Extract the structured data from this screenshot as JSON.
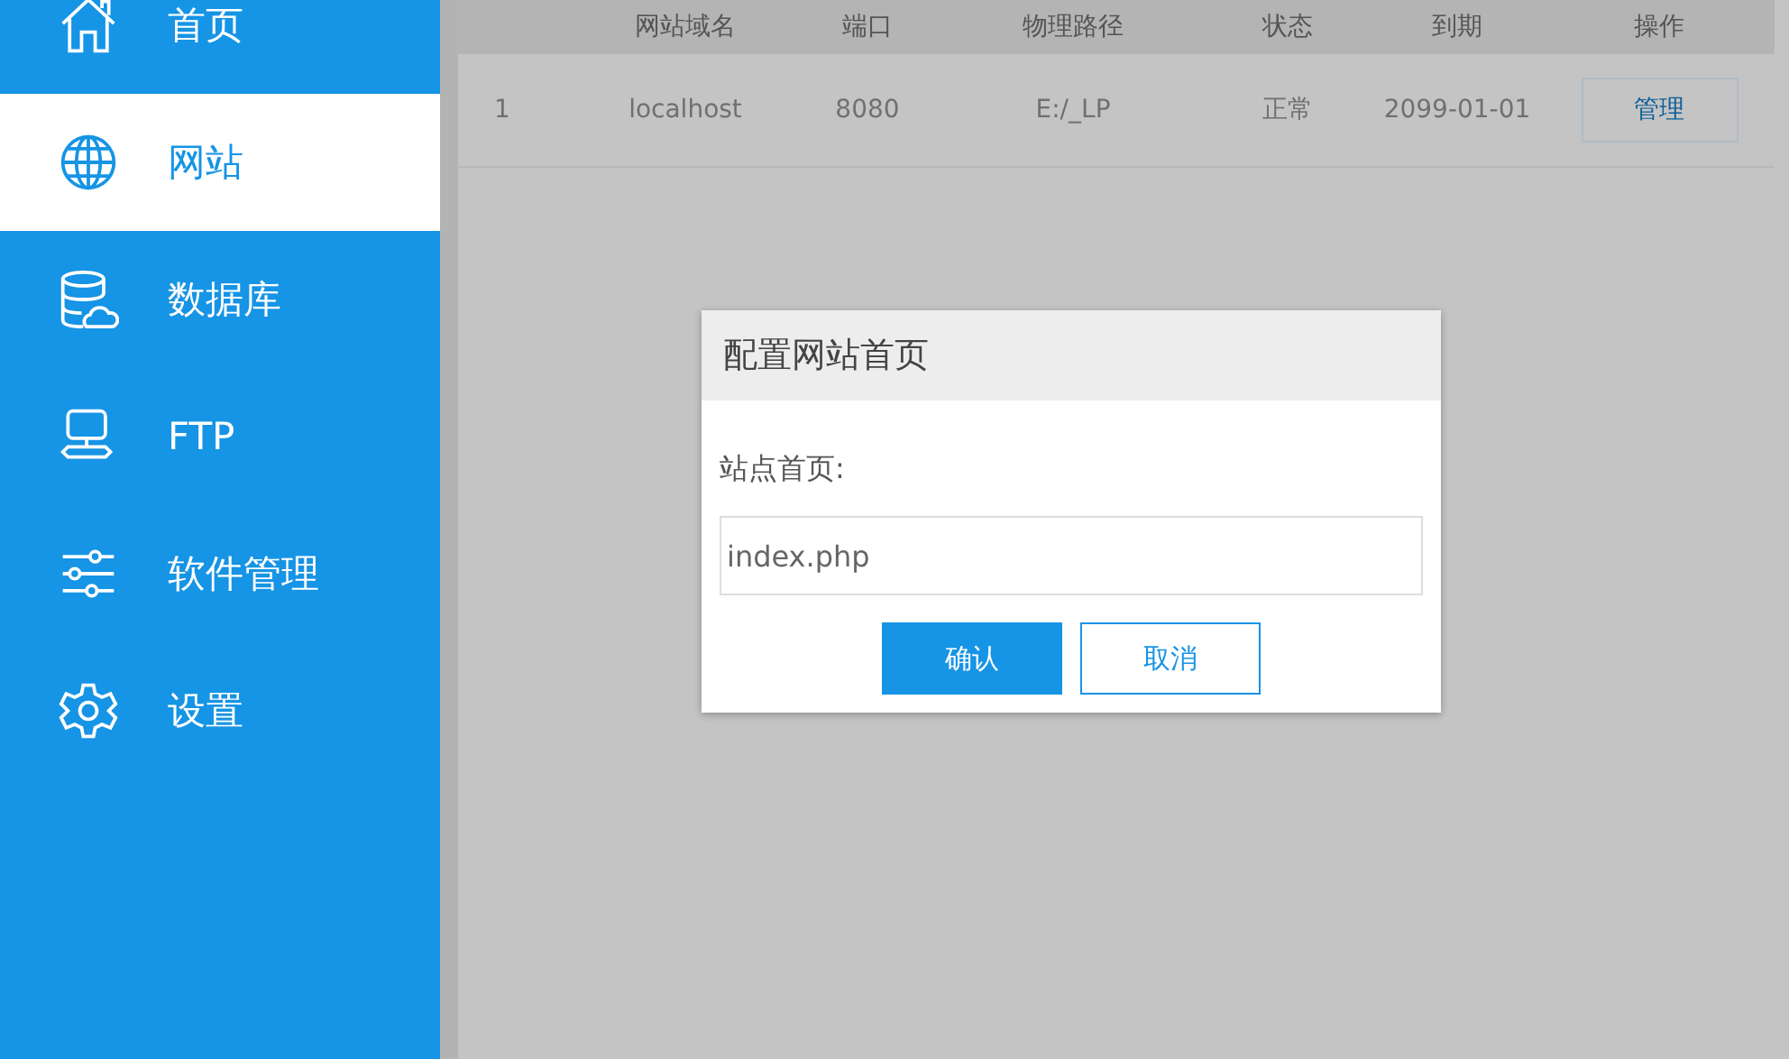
{
  "sidebar": {
    "items": [
      {
        "label": "首页",
        "kind": "home",
        "selected": false
      },
      {
        "label": "网站",
        "kind": "globe",
        "selected": true
      },
      {
        "label": "数据库",
        "kind": "database",
        "selected": false
      },
      {
        "label": "FTP",
        "kind": "network",
        "selected": false
      },
      {
        "label": "软件管理",
        "kind": "sliders",
        "selected": false
      },
      {
        "label": "设置",
        "kind": "gear",
        "selected": false
      }
    ]
  },
  "table": {
    "columns": [
      "",
      "网站域名",
      "端口",
      "物理路径",
      "状态",
      "到期",
      "操作"
    ],
    "rows": [
      {
        "cells": [
          "1",
          "localhost",
          "8080",
          "E:/_LP",
          "正常",
          "2099-01-01"
        ],
        "action": "管理"
      }
    ]
  },
  "dialog": {
    "title": "配置网站首页",
    "label": "站点首页:",
    "value": "index.php",
    "buttons": [
      {
        "label": "确认",
        "kind": "primary"
      },
      {
        "label": "取消",
        "kind": "secondary"
      }
    ]
  }
}
